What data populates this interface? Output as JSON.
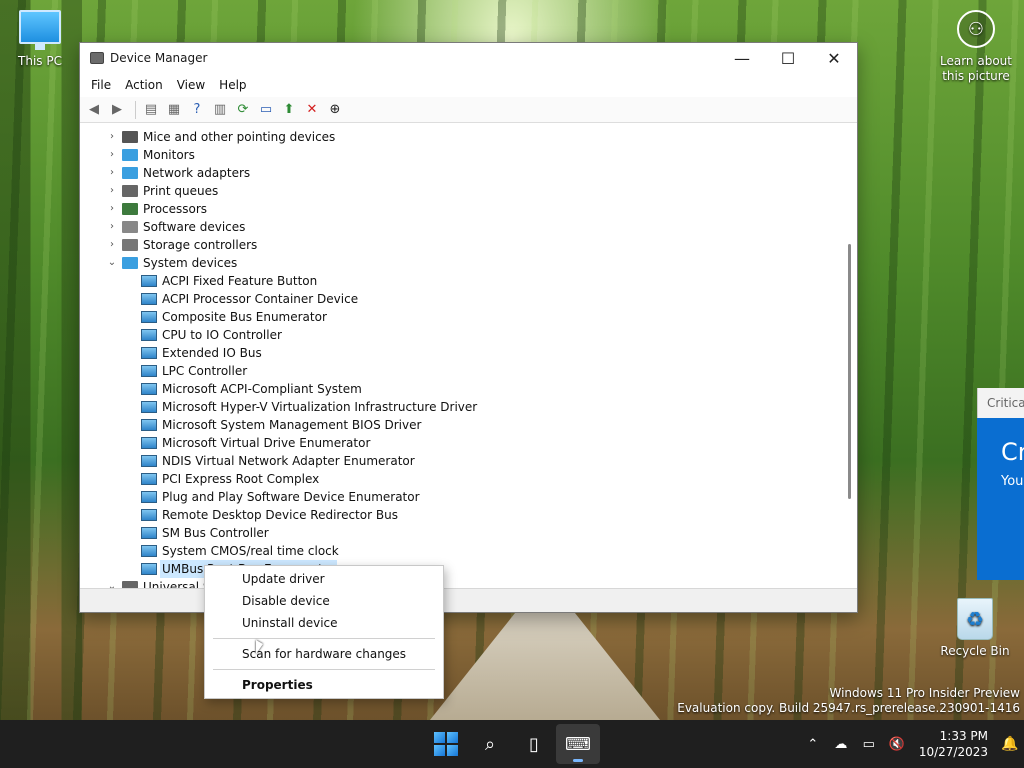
{
  "desktop": {
    "this_pc": "This PC",
    "recycle_bin": "Recycle Bin",
    "learn_line1": "Learn about",
    "learn_line2": "this picture",
    "watermark_line1": "Windows 11 Pro Insider Preview",
    "watermark_line2": "Evaluation copy. Build 25947.rs_prerelease.230901-1416"
  },
  "critical_popup": {
    "header": "Critical",
    "big": "Cr",
    "small": "You"
  },
  "window": {
    "title": "Device Manager",
    "menu": [
      "File",
      "Action",
      "View",
      "Help"
    ],
    "categories": [
      {
        "label": "Mice and other pointing devices",
        "expanded": false,
        "color": "#555555"
      },
      {
        "label": "Monitors",
        "expanded": false,
        "color": "#3a9fe0"
      },
      {
        "label": "Network adapters",
        "expanded": false,
        "color": "#3a9fe0"
      },
      {
        "label": "Print queues",
        "expanded": false,
        "color": "#666666"
      },
      {
        "label": "Processors",
        "expanded": false,
        "color": "#3d7a3d"
      },
      {
        "label": "Software devices",
        "expanded": false,
        "color": "#888888"
      },
      {
        "label": "Storage controllers",
        "expanded": false,
        "color": "#777777"
      },
      {
        "label": "System devices",
        "expanded": true,
        "color": "#3a9fe0"
      }
    ],
    "system_devices": [
      "ACPI Fixed Feature Button",
      "ACPI Processor Container Device",
      "Composite Bus Enumerator",
      "CPU to IO Controller",
      "Extended IO Bus",
      "LPC Controller",
      "Microsoft ACPI-Compliant System",
      "Microsoft Hyper-V Virtualization Infrastructure Driver",
      "Microsoft System Management BIOS Driver",
      "Microsoft Virtual Drive Enumerator",
      "NDIS Virtual Network Adapter Enumerator",
      "PCI Express Root Complex",
      "Plug and Play Software Device Enumerator",
      "Remote Desktop Device Redirector Bus",
      "SM Bus Controller",
      "System CMOS/real time clock",
      "UMBus Root Bus Enumerator"
    ],
    "last_category": "Universal Serial Bus controllers"
  },
  "context_menu": {
    "update_driver": "Update driver",
    "disable_device": "Disable device",
    "uninstall_device": "Uninstall device",
    "scan": "Scan for hardware changes",
    "properties": "Properties"
  },
  "taskbar": {
    "time": "1:33 PM",
    "date": "10/27/2023"
  }
}
